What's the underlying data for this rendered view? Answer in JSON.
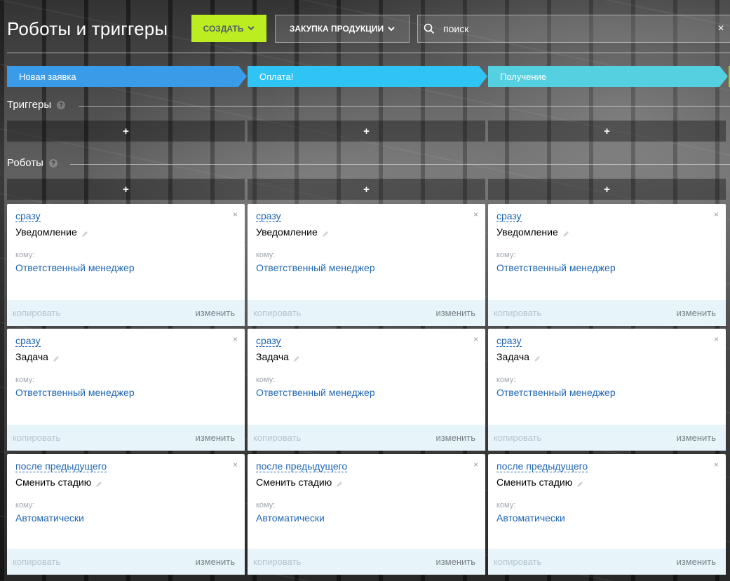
{
  "header": {
    "title": "Роботы и триггеры",
    "create_label": "СОЗДАТЬ",
    "category_label": "ЗАКУПКА ПРОДУКЦИИ",
    "search": {
      "value": "поиск",
      "placeholder": "поиск"
    }
  },
  "stages": [
    {
      "label": "Новая заявка",
      "color": "#3a9ce8"
    },
    {
      "label": "Оплата!",
      "color": "#2fc4f4"
    },
    {
      "label": "Получение",
      "color": "#55d0e0"
    },
    {
      "label": "",
      "color": "#9acd32"
    }
  ],
  "sections": {
    "triggers": "Триггеры",
    "robots": "Роботы",
    "help": "?",
    "add": "+"
  },
  "robots": [
    [
      {
        "delay": "сразу",
        "type": "Уведомление",
        "to_label": "кому:",
        "to_value": "Ответственный менеджер",
        "copy": "копировать",
        "edit": "изменить"
      },
      {
        "delay": "сразу",
        "type": "Задача",
        "to_label": "кому:",
        "to_value": "Ответственный менеджер",
        "copy": "копировать",
        "edit": "изменить"
      },
      {
        "delay": "после предыдущего",
        "type": "Сменить стадию",
        "to_label": "кому:",
        "to_value": "Автоматически",
        "copy": "копировать",
        "edit": "изменить"
      }
    ],
    [
      {
        "delay": "сразу",
        "type": "Уведомление",
        "to_label": "кому:",
        "to_value": "Ответственный менеджер",
        "copy": "копировать",
        "edit": "изменить"
      },
      {
        "delay": "сразу",
        "type": "Задача",
        "to_label": "кому:",
        "to_value": "Ответственный менеджер",
        "copy": "копировать",
        "edit": "изменить"
      },
      {
        "delay": "после предыдущего",
        "type": "Сменить стадию",
        "to_label": "кому:",
        "to_value": "Автоматически",
        "copy": "копировать",
        "edit": "изменить"
      }
    ],
    [
      {
        "delay": "сразу",
        "type": "Уведомление",
        "to_label": "кому:",
        "to_value": "Ответственный менеджер",
        "copy": "копировать",
        "edit": "изменить"
      },
      {
        "delay": "сразу",
        "type": "Задача",
        "to_label": "кому:",
        "to_value": "Ответственный менеджер",
        "copy": "копировать",
        "edit": "изменить"
      },
      {
        "delay": "после предыдущего",
        "type": "Сменить стадию",
        "to_label": "кому:",
        "to_value": "Автоматически",
        "copy": "копировать",
        "edit": "изменить"
      }
    ]
  ],
  "icons": {
    "close": "×",
    "chevron": "chevron-down-icon",
    "search": "search-icon",
    "pencil": "pencil-icon"
  }
}
